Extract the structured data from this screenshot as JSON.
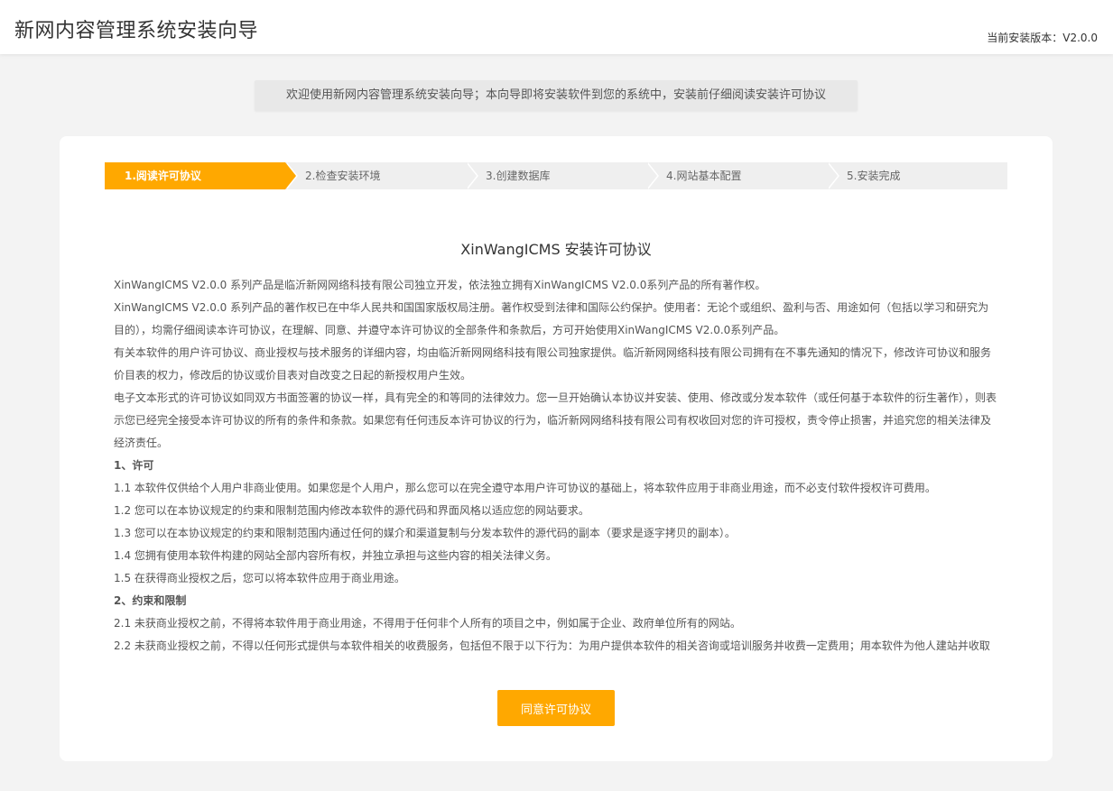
{
  "header": {
    "title": "新网内容管理系统安装向导",
    "version_label": "当前安装版本：V2.0.0"
  },
  "welcome": "欢迎使用新网内容管理系统安装向导；本向导即将安装软件到您的系统中，安装前仔细阅读安装许可协议",
  "steps": [
    {
      "label": "1.阅读许可协议",
      "active": true
    },
    {
      "label": "2.检查安装环境",
      "active": false
    },
    {
      "label": "3.创建数据库",
      "active": false
    },
    {
      "label": "4.网站基本配置",
      "active": false
    },
    {
      "label": "5.安装完成",
      "active": false
    }
  ],
  "license": {
    "title": "XinWangICMS 安装许可协议",
    "paragraphs": [
      "XinWangICMS V2.0.0 系列产品是临沂新网网络科技有限公司独立开发，依法独立拥有XinWangICMS V2.0.0系列产品的所有著作权。",
      "XinWangICMS V2.0.0 系列产品的著作权已在中华人民共和国国家版权局注册。著作权受到法律和国际公约保护。使用者：无论个或组织、盈利与否、用途如何（包括以学习和研究为目的），均需仔细阅读本许可协议，在理解、同意、并遵守本许可协议的全部条件和条款后，方可开始使用XinWangICMS V2.0.0系列产品。",
      "有关本软件的用户许可协议、商业授权与技术服务的详细内容，均由临沂新网网络科技有限公司独家提供。临沂新网网络科技有限公司拥有在不事先通知的情况下，修改许可协议和服务价目表的权力，修改后的协议或价目表对自改变之日起的新授权用户生效。",
      "电子文本形式的许可协议如同双方书面签署的协议一样，具有完全的和等同的法律效力。您一旦开始确认本协议并安装、使用、修改或分发本软件（或任何基于本软件的衍生著作），则表示您已经完全接受本许可协议的所有的条件和条款。如果您有任何违反本许可协议的行为，临沂新网网络科技有限公司有权收回对您的许可授权，责令停止损害，并追究您的相关法律及经济责任。",
      "1、许可",
      "1.1 本软件仅供给个人用户非商业使用。如果您是个人用户，那么您可以在完全遵守本用户许可协议的基础上，将本软件应用于非商业用途，而不必支付软件授权许可费用。",
      "1.2 您可以在本协议规定的约束和限制范围内修改本软件的源代码和界面风格以适应您的网站要求。",
      "1.3 您可以在本协议规定的约束和限制范围内通过任何的媒介和渠道复制与分发本软件的源代码的副本（要求是逐字拷贝的副本）。",
      "1.4 您拥有使用本软件构建的网站全部内容所有权，并独立承担与这些内容的相关法律义务。",
      "1.5 在获得商业授权之后，您可以将本软件应用于商业用途。",
      "2、约束和限制",
      "2.1 未获商业授权之前，不得将本软件用于商业用途，不得用于任何非个人所有的项目之中，例如属于企业、政府单位所有的网站。",
      "2.2 未获商业授权之前，不得以任何形式提供与本软件相关的收费服务，包括但不限于以下行为：为用户提供本软件的相关咨询或培训服务并收费一定费用；用本软件为他人建站并收取"
    ]
  },
  "agree_button": "同意许可协议",
  "colors": {
    "accent": "#ffa800",
    "background": "#f3f3f3",
    "step_inactive": "#efefef"
  }
}
